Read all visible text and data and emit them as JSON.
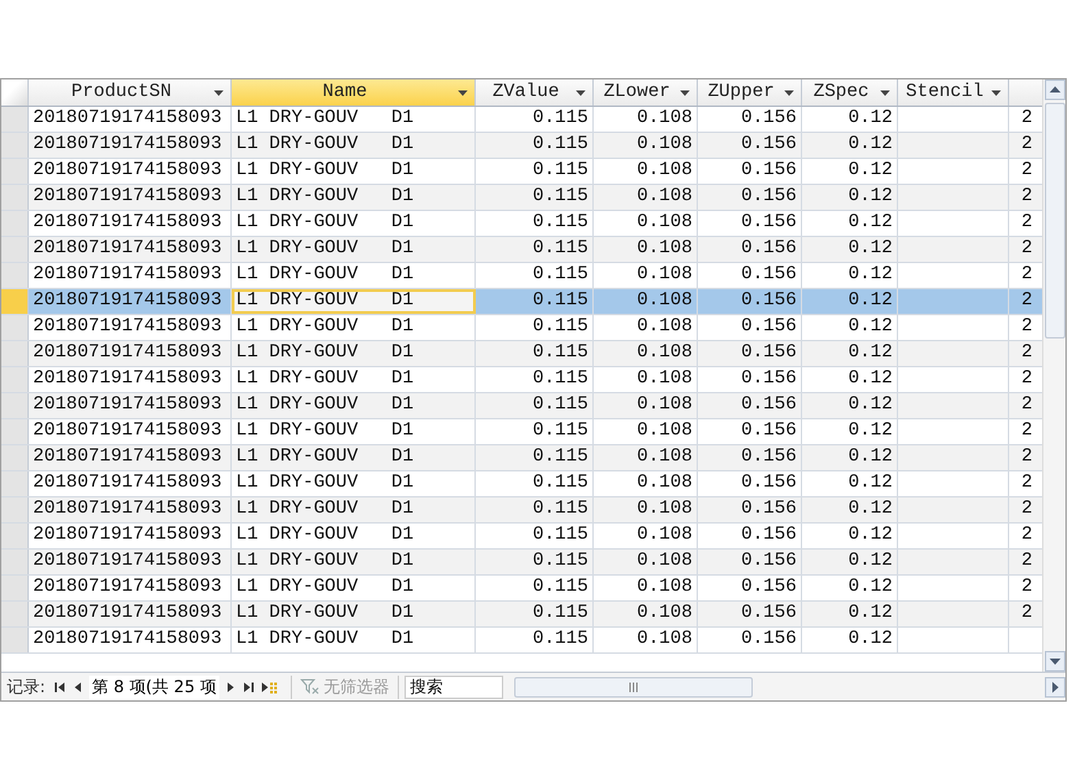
{
  "table": {
    "columns": [
      {
        "label": "ProductSN",
        "selected": false
      },
      {
        "label": "Name",
        "selected": true
      },
      {
        "label": "ZValue",
        "selected": false
      },
      {
        "label": "ZLower",
        "selected": false
      },
      {
        "label": "ZUpper",
        "selected": false
      },
      {
        "label": "ZSpec",
        "selected": false
      },
      {
        "label": "Stencil",
        "selected": false
      }
    ],
    "rows": [
      {
        "product_sn": "20180719174158093",
        "name": "L1 DRY-GOUV   D1",
        "zvalue": "0.115",
        "zlower": "0.108",
        "zupper": "0.156",
        "zspec": "0.12",
        "column_8": "2",
        "selected": false
      },
      {
        "product_sn": "20180719174158093",
        "name": "L1 DRY-GOUV   D1",
        "zvalue": "0.115",
        "zlower": "0.108",
        "zupper": "0.156",
        "zspec": "0.12",
        "column_8": "2",
        "selected": false
      },
      {
        "product_sn": "20180719174158093",
        "name": "L1 DRY-GOUV   D1",
        "zvalue": "0.115",
        "zlower": "0.108",
        "zupper": "0.156",
        "zspec": "0.12",
        "column_8": "2",
        "selected": false
      },
      {
        "product_sn": "20180719174158093",
        "name": "L1 DRY-GOUV   D1",
        "zvalue": "0.115",
        "zlower": "0.108",
        "zupper": "0.156",
        "zspec": "0.12",
        "column_8": "2",
        "selected": false
      },
      {
        "product_sn": "20180719174158093",
        "name": "L1 DRY-GOUV   D1",
        "zvalue": "0.115",
        "zlower": "0.108",
        "zupper": "0.156",
        "zspec": "0.12",
        "column_8": "2",
        "selected": false
      },
      {
        "product_sn": "20180719174158093",
        "name": "L1 DRY-GOUV   D1",
        "zvalue": "0.115",
        "zlower": "0.108",
        "zupper": "0.156",
        "zspec": "0.12",
        "column_8": "2",
        "selected": false
      },
      {
        "product_sn": "20180719174158093",
        "name": "L1 DRY-GOUV   D1",
        "zvalue": "0.115",
        "zlower": "0.108",
        "zupper": "0.156",
        "zspec": "0.12",
        "column_8": "2",
        "selected": false
      },
      {
        "product_sn": "20180719174158093",
        "name": "L1 DRY-GOUV   D1",
        "zvalue": "0.115",
        "zlower": "0.108",
        "zupper": "0.156",
        "zspec": "0.12",
        "column_8": "2",
        "selected": true
      },
      {
        "product_sn": "20180719174158093",
        "name": "L1 DRY-GOUV   D1",
        "zvalue": "0.115",
        "zlower": "0.108",
        "zupper": "0.156",
        "zspec": "0.12",
        "column_8": "2",
        "selected": false
      },
      {
        "product_sn": "20180719174158093",
        "name": "L1 DRY-GOUV   D1",
        "zvalue": "0.115",
        "zlower": "0.108",
        "zupper": "0.156",
        "zspec": "0.12",
        "column_8": "2",
        "selected": false
      },
      {
        "product_sn": "20180719174158093",
        "name": "L1 DRY-GOUV   D1",
        "zvalue": "0.115",
        "zlower": "0.108",
        "zupper": "0.156",
        "zspec": "0.12",
        "column_8": "2",
        "selected": false
      },
      {
        "product_sn": "20180719174158093",
        "name": "L1 DRY-GOUV   D1",
        "zvalue": "0.115",
        "zlower": "0.108",
        "zupper": "0.156",
        "zspec": "0.12",
        "column_8": "2",
        "selected": false
      },
      {
        "product_sn": "20180719174158093",
        "name": "L1 DRY-GOUV   D1",
        "zvalue": "0.115",
        "zlower": "0.108",
        "zupper": "0.156",
        "zspec": "0.12",
        "column_8": "2",
        "selected": false
      },
      {
        "product_sn": "20180719174158093",
        "name": "L1 DRY-GOUV   D1",
        "zvalue": "0.115",
        "zlower": "0.108",
        "zupper": "0.156",
        "zspec": "0.12",
        "column_8": "2",
        "selected": false
      },
      {
        "product_sn": "20180719174158093",
        "name": "L1 DRY-GOUV   D1",
        "zvalue": "0.115",
        "zlower": "0.108",
        "zupper": "0.156",
        "zspec": "0.12",
        "column_8": "2",
        "selected": false
      },
      {
        "product_sn": "20180719174158093",
        "name": "L1 DRY-GOUV   D1",
        "zvalue": "0.115",
        "zlower": "0.108",
        "zupper": "0.156",
        "zspec": "0.12",
        "column_8": "2",
        "selected": false
      },
      {
        "product_sn": "20180719174158093",
        "name": "L1 DRY-GOUV   D1",
        "zvalue": "0.115",
        "zlower": "0.108",
        "zupper": "0.156",
        "zspec": "0.12",
        "column_8": "2",
        "selected": false
      },
      {
        "product_sn": "20180719174158093",
        "name": "L1 DRY-GOUV   D1",
        "zvalue": "0.115",
        "zlower": "0.108",
        "zupper": "0.156",
        "zspec": "0.12",
        "column_8": "2",
        "selected": false
      },
      {
        "product_sn": "20180719174158093",
        "name": "L1 DRY-GOUV   D1",
        "zvalue": "0.115",
        "zlower": "0.108",
        "zupper": "0.156",
        "zspec": "0.12",
        "column_8": "2",
        "selected": false
      },
      {
        "product_sn": "20180719174158093",
        "name": "L1 DRY-GOUV   D1",
        "zvalue": "0.115",
        "zlower": "0.108",
        "zupper": "0.156",
        "zspec": "0.12",
        "column_8": "2",
        "selected": false
      },
      {
        "product_sn": "20180719174158093",
        "name": "L1 DRY-GOUV   D1",
        "zvalue": "0.115",
        "zlower": "0.108",
        "zupper": "0.156",
        "zspec": "0.12",
        "selected": false
      }
    ]
  },
  "navigation": {
    "label": "记录:",
    "position": "第 8 项(共 25 项",
    "filter": {
      "label": "无筛选器",
      "disabled": true
    },
    "search": {
      "placeholder": "搜索"
    }
  }
}
